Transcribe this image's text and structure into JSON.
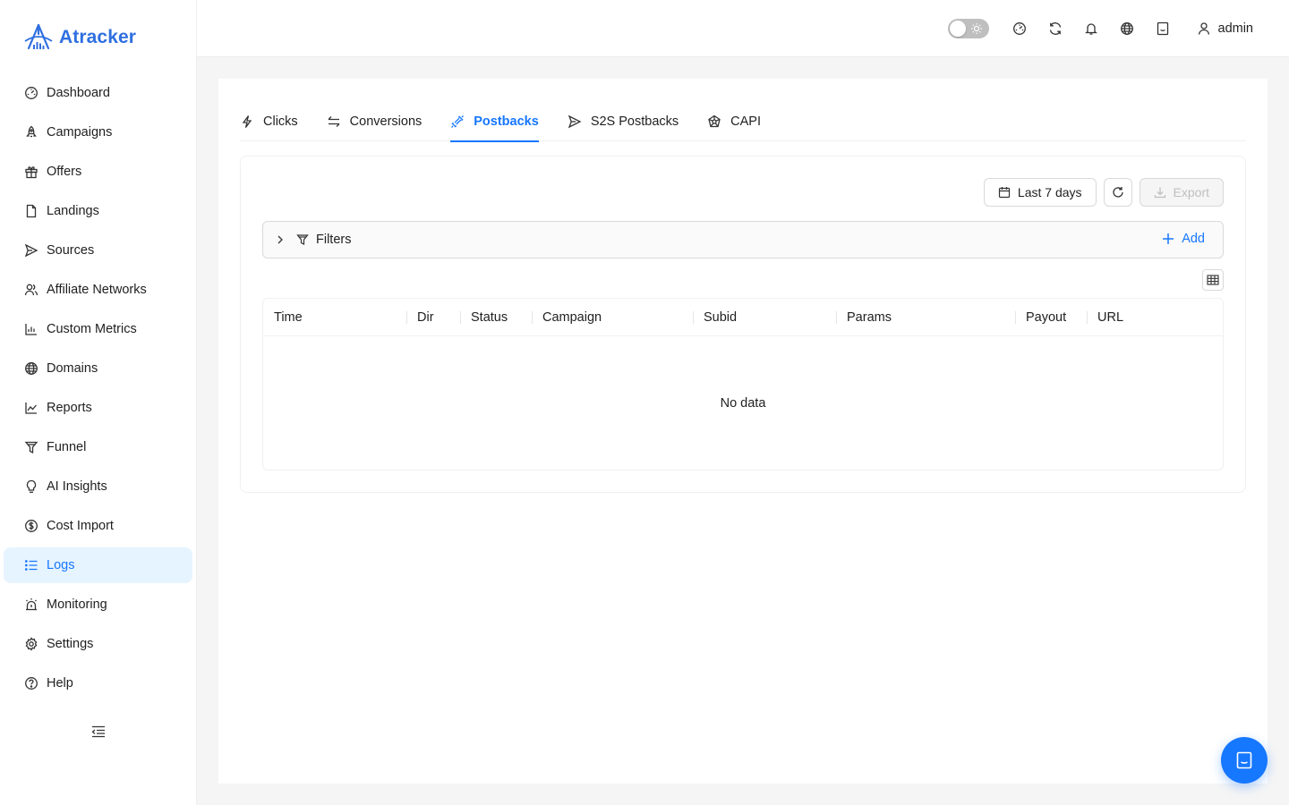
{
  "app": {
    "name": "Atracker"
  },
  "sidebar": {
    "items": [
      {
        "label": "Dashboard",
        "icon": "dashboard-icon"
      },
      {
        "label": "Campaigns",
        "icon": "rocket-icon"
      },
      {
        "label": "Offers",
        "icon": "gift-icon"
      },
      {
        "label": "Landings",
        "icon": "file-icon"
      },
      {
        "label": "Sources",
        "icon": "send-icon"
      },
      {
        "label": "Affiliate Networks",
        "icon": "users-icon"
      },
      {
        "label": "Custom Metrics",
        "icon": "bar-chart-icon"
      },
      {
        "label": "Domains",
        "icon": "globe-icon"
      },
      {
        "label": "Reports",
        "icon": "line-chart-icon"
      },
      {
        "label": "Funnel",
        "icon": "funnel-icon"
      },
      {
        "label": "AI Insights",
        "icon": "bulb-icon"
      },
      {
        "label": "Cost Import",
        "icon": "dollar-icon"
      },
      {
        "label": "Logs",
        "icon": "list-icon",
        "active": true
      },
      {
        "label": "Monitoring",
        "icon": "alarm-icon"
      },
      {
        "label": "Settings",
        "icon": "gear-icon"
      },
      {
        "label": "Help",
        "icon": "question-icon"
      }
    ]
  },
  "header": {
    "theme_toggle": "light",
    "user": "admin"
  },
  "tabs": [
    {
      "label": "Clicks",
      "icon": "bolt-icon"
    },
    {
      "label": "Conversions",
      "icon": "swap-icon"
    },
    {
      "label": "Postbacks",
      "icon": "api-icon",
      "active": true
    },
    {
      "label": "S2S Postbacks",
      "icon": "send-icon"
    },
    {
      "label": "CAPI",
      "icon": "cluster-icon"
    }
  ],
  "toolbar": {
    "date_range": "Last 7 days",
    "export_label": "Export"
  },
  "filters": {
    "label": "Filters",
    "add_label": "Add"
  },
  "table": {
    "columns": [
      "Time",
      "Dir",
      "Status",
      "Campaign",
      "Subid",
      "Params",
      "Payout",
      "URL"
    ],
    "empty_text": "No data"
  },
  "colors": {
    "accent": "#1677ff",
    "brand": "#2f6fe0",
    "active_bg": "#e6f4ff"
  }
}
